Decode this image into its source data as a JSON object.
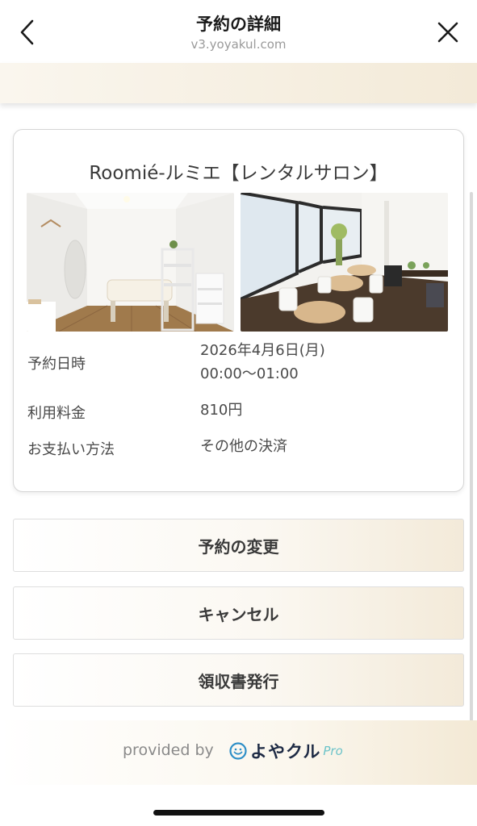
{
  "header": {
    "title": "予約の詳細",
    "domain": "v3.yoyakul.com",
    "back_icon": "chevron-left-icon",
    "close_icon": "close-icon"
  },
  "reservation": {
    "salon_name": "Roomié-ルミエ【レンタルサロン】",
    "rows": [
      {
        "label": "予約日時",
        "value_line1": "2026年4月6日(月)",
        "value_line2": "00:00〜01:00"
      },
      {
        "label": "利用料金",
        "value_line1": "810円"
      },
      {
        "label": "お支払い方法",
        "value_line1": "その他の決済"
      }
    ]
  },
  "actions": {
    "change_label": "予約の変更",
    "cancel_label": "キャンセル",
    "receipt_label": "領収書発行"
  },
  "footer": {
    "provided_by": "provided by",
    "logo_text": "よやクル",
    "logo_suffix": "Pro"
  },
  "colors": {
    "accent_beige": "#f3ead8",
    "text": "#3a3a3a",
    "logo_navy": "#1d2a44",
    "logo_teal": "#6cc3c9"
  }
}
